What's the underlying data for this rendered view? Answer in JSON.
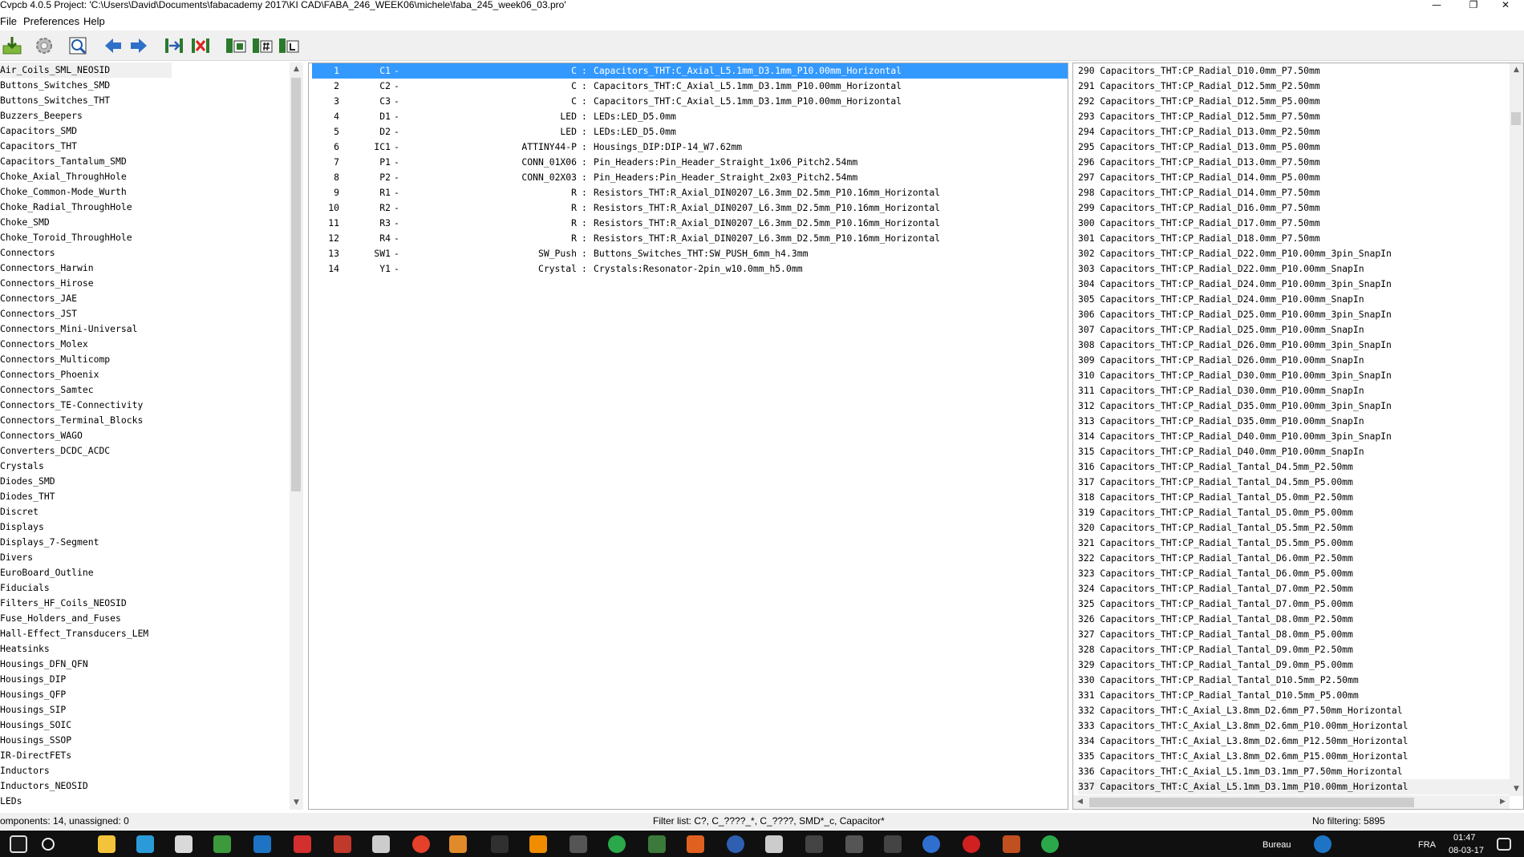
{
  "window": {
    "title": "Cvpcb 4.0.5  Project: 'C:\\Users\\David\\Documents\\fabacademy 2017\\KI CAD\\FABA_246_WEEK06\\michele\\faba_245_week06_03.pro'",
    "minimize_glyph": "—",
    "maximize_glyph": "❐",
    "close_glyph": "✕"
  },
  "menu": {
    "file": "File",
    "preferences": "Preferences",
    "help": "Help"
  },
  "toolbar": {
    "buttons": [
      "save-icon",
      "config-icon",
      "footprint-view-icon",
      "prev-arrow-icon",
      "next-arrow-icon",
      "auto-associate-icon",
      "delete-associations-icon",
      "filter-keyword-icon",
      "filter-pincount-icon",
      "filter-library-icon"
    ]
  },
  "libraries": [
    "Air_Coils_SML_NEOSID",
    "Buttons_Switches_SMD",
    "Buttons_Switches_THT",
    "Buzzers_Beepers",
    "Capacitors_SMD",
    "Capacitors_THT",
    "Capacitors_Tantalum_SMD",
    "Choke_Axial_ThroughHole",
    "Choke_Common-Mode_Wurth",
    "Choke_Radial_ThroughHole",
    "Choke_SMD",
    "Choke_Toroid_ThroughHole",
    "Connectors",
    "Connectors_Harwin",
    "Connectors_Hirose",
    "Connectors_JAE",
    "Connectors_JST",
    "Connectors_Mini-Universal",
    "Connectors_Molex",
    "Connectors_Multicomp",
    "Connectors_Phoenix",
    "Connectors_Samtec",
    "Connectors_TE-Connectivity",
    "Connectors_Terminal_Blocks",
    "Connectors_WAGO",
    "Converters_DCDC_ACDC",
    "Crystals",
    "Diodes_SMD",
    "Diodes_THT",
    "Discret",
    "Displays",
    "Displays_7-Segment",
    "Divers",
    "EuroBoard_Outline",
    "Fiducials",
    "Filters_HF_Coils_NEOSID",
    "Fuse_Holders_and_Fuses",
    "Hall-Effect_Transducers_LEM",
    "Heatsinks",
    "Housings_DFN_QFN",
    "Housings_DIP",
    "Housings_QFP",
    "Housings_SIP",
    "Housings_SOIC",
    "Housings_SSOP",
    "IR-DirectFETs",
    "Inductors",
    "Inductors_NEOSID",
    "LEDs"
  ],
  "components": [
    {
      "num": "1",
      "ref": "C1",
      "value": "C",
      "footprint": "Capacitors_THT:C_Axial_L5.1mm_D3.1mm_P10.00mm_Horizontal"
    },
    {
      "num": "2",
      "ref": "C2",
      "value": "C",
      "footprint": "Capacitors_THT:C_Axial_L5.1mm_D3.1mm_P10.00mm_Horizontal"
    },
    {
      "num": "3",
      "ref": "C3",
      "value": "C",
      "footprint": "Capacitors_THT:C_Axial_L5.1mm_D3.1mm_P10.00mm_Horizontal"
    },
    {
      "num": "4",
      "ref": "D1",
      "value": "LED",
      "footprint": "LEDs:LED_D5.0mm"
    },
    {
      "num": "5",
      "ref": "D2",
      "value": "LED",
      "footprint": "LEDs:LED_D5.0mm"
    },
    {
      "num": "6",
      "ref": "IC1",
      "value": "ATTINY44-P",
      "footprint": "Housings_DIP:DIP-14_W7.62mm"
    },
    {
      "num": "7",
      "ref": "P1",
      "value": "CONN_01X06",
      "footprint": "Pin_Headers:Pin_Header_Straight_1x06_Pitch2.54mm"
    },
    {
      "num": "8",
      "ref": "P2",
      "value": "CONN_02X03",
      "footprint": "Pin_Headers:Pin_Header_Straight_2x03_Pitch2.54mm"
    },
    {
      "num": "9",
      "ref": "R1",
      "value": "R",
      "footprint": "Resistors_THT:R_Axial_DIN0207_L6.3mm_D2.5mm_P10.16mm_Horizontal"
    },
    {
      "num": "10",
      "ref": "R2",
      "value": "R",
      "footprint": "Resistors_THT:R_Axial_DIN0207_L6.3mm_D2.5mm_P10.16mm_Horizontal"
    },
    {
      "num": "11",
      "ref": "R3",
      "value": "R",
      "footprint": "Resistors_THT:R_Axial_DIN0207_L6.3mm_D2.5mm_P10.16mm_Horizontal"
    },
    {
      "num": "12",
      "ref": "R4",
      "value": "R",
      "footprint": "Resistors_THT:R_Axial_DIN0207_L6.3mm_D2.5mm_P10.16mm_Horizontal"
    },
    {
      "num": "13",
      "ref": "SW1",
      "value": "SW_Push",
      "footprint": "Buttons_Switches_THT:SW_PUSH_6mm_h4.3mm"
    },
    {
      "num": "14",
      "ref": "Y1",
      "value": "Crystal",
      "footprint": "Crystals:Resonator-2pin_w10.0mm_h5.0mm"
    }
  ],
  "footprints": [
    "290 Capacitors_THT:CP_Radial_D10.0mm_P7.50mm",
    "291 Capacitors_THT:CP_Radial_D12.5mm_P2.50mm",
    "292 Capacitors_THT:CP_Radial_D12.5mm_P5.00mm",
    "293 Capacitors_THT:CP_Radial_D12.5mm_P7.50mm",
    "294 Capacitors_THT:CP_Radial_D13.0mm_P2.50mm",
    "295 Capacitors_THT:CP_Radial_D13.0mm_P5.00mm",
    "296 Capacitors_THT:CP_Radial_D13.0mm_P7.50mm",
    "297 Capacitors_THT:CP_Radial_D14.0mm_P5.00mm",
    "298 Capacitors_THT:CP_Radial_D14.0mm_P7.50mm",
    "299 Capacitors_THT:CP_Radial_D16.0mm_P7.50mm",
    "300 Capacitors_THT:CP_Radial_D17.0mm_P7.50mm",
    "301 Capacitors_THT:CP_Radial_D18.0mm_P7.50mm",
    "302 Capacitors_THT:CP_Radial_D22.0mm_P10.00mm_3pin_SnapIn",
    "303 Capacitors_THT:CP_Radial_D22.0mm_P10.00mm_SnapIn",
    "304 Capacitors_THT:CP_Radial_D24.0mm_P10.00mm_3pin_SnapIn",
    "305 Capacitors_THT:CP_Radial_D24.0mm_P10.00mm_SnapIn",
    "306 Capacitors_THT:CP_Radial_D25.0mm_P10.00mm_3pin_SnapIn",
    "307 Capacitors_THT:CP_Radial_D25.0mm_P10.00mm_SnapIn",
    "308 Capacitors_THT:CP_Radial_D26.0mm_P10.00mm_3pin_SnapIn",
    "309 Capacitors_THT:CP_Radial_D26.0mm_P10.00mm_SnapIn",
    "310 Capacitors_THT:CP_Radial_D30.0mm_P10.00mm_3pin_SnapIn",
    "311 Capacitors_THT:CP_Radial_D30.0mm_P10.00mm_SnapIn",
    "312 Capacitors_THT:CP_Radial_D35.0mm_P10.00mm_3pin_SnapIn",
    "313 Capacitors_THT:CP_Radial_D35.0mm_P10.00mm_SnapIn",
    "314 Capacitors_THT:CP_Radial_D40.0mm_P10.00mm_3pin_SnapIn",
    "315 Capacitors_THT:CP_Radial_D40.0mm_P10.00mm_SnapIn",
    "316 Capacitors_THT:CP_Radial_Tantal_D4.5mm_P2.50mm",
    "317 Capacitors_THT:CP_Radial_Tantal_D4.5mm_P5.00mm",
    "318 Capacitors_THT:CP_Radial_Tantal_D5.0mm_P2.50mm",
    "319 Capacitors_THT:CP_Radial_Tantal_D5.0mm_P5.00mm",
    "320 Capacitors_THT:CP_Radial_Tantal_D5.5mm_P2.50mm",
    "321 Capacitors_THT:CP_Radial_Tantal_D5.5mm_P5.00mm",
    "322 Capacitors_THT:CP_Radial_Tantal_D6.0mm_P2.50mm",
    "323 Capacitors_THT:CP_Radial_Tantal_D6.0mm_P5.00mm",
    "324 Capacitors_THT:CP_Radial_Tantal_D7.0mm_P2.50mm",
    "325 Capacitors_THT:CP_Radial_Tantal_D7.0mm_P5.00mm",
    "326 Capacitors_THT:CP_Radial_Tantal_D8.0mm_P2.50mm",
    "327 Capacitors_THT:CP_Radial_Tantal_D8.0mm_P5.00mm",
    "328 Capacitors_THT:CP_Radial_Tantal_D9.0mm_P2.50mm",
    "329 Capacitors_THT:CP_Radial_Tantal_D9.0mm_P5.00mm",
    "330 Capacitors_THT:CP_Radial_Tantal_D10.5mm_P2.50mm",
    "331 Capacitors_THT:CP_Radial_Tantal_D10.5mm_P5.00mm",
    "332 Capacitors_THT:C_Axial_L3.8mm_D2.6mm_P7.50mm_Horizontal",
    "333 Capacitors_THT:C_Axial_L3.8mm_D2.6mm_P10.00mm_Horizontal",
    "334 Capacitors_THT:C_Axial_L3.8mm_D2.6mm_P12.50mm_Horizontal",
    "335 Capacitors_THT:C_Axial_L3.8mm_D2.6mm_P15.00mm_Horizontal",
    "336 Capacitors_THT:C_Axial_L5.1mm_D3.1mm_P7.50mm_Horizontal",
    "337 Capacitors_THT:C_Axial_L5.1mm_D3.1mm_P10.00mm_Horizontal"
  ],
  "status": {
    "components": "omponents: 14, unassigned: 0",
    "filter": "Filter list: C?, C_????_*, C_????, SMD*_c, Capacitor*",
    "filtering": "No filtering: 5895"
  },
  "taskbar": {
    "bureau": "Bureau",
    "lang": "FRA",
    "time": "01:47",
    "date": "08-03-17"
  },
  "colors": {
    "selection": "#3399ff",
    "toolbar_bg": "#f0f0f0",
    "taskbar_bg": "#101010"
  }
}
